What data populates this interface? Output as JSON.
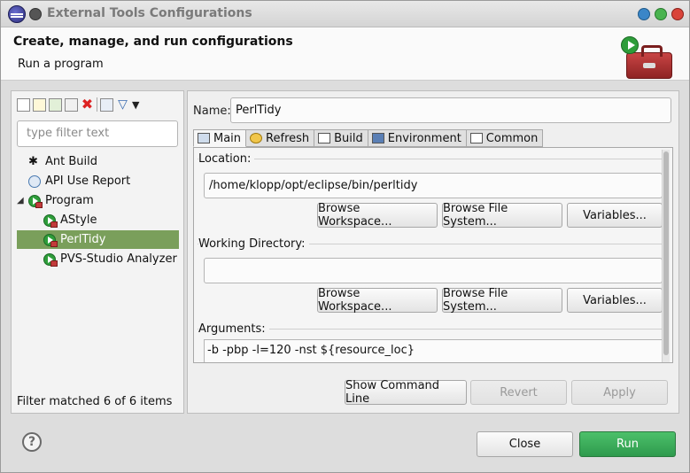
{
  "window": {
    "title": "External Tools Configurations"
  },
  "header": {
    "title": "Create, manage, and run configurations",
    "subtitle": "Run a program"
  },
  "left": {
    "filter_placeholder": "type filter text",
    "tree": [
      {
        "label": "Ant Build",
        "icon": "ant-icon",
        "level": 1
      },
      {
        "label": "API Use Report",
        "icon": "api-report-icon",
        "level": 1
      },
      {
        "label": "Program",
        "icon": "program-icon",
        "level": 0,
        "expanded": true
      },
      {
        "label": "AStyle",
        "icon": "program-config-icon",
        "level": 1
      },
      {
        "label": "PerlTidy",
        "icon": "program-config-icon",
        "level": 1,
        "selected": true
      },
      {
        "label": "PVS-Studio Analyzer",
        "icon": "program-config-icon",
        "level": 1
      }
    ],
    "status": "Filter matched 6 of 6 items"
  },
  "right": {
    "name_label": "Name:",
    "name_value": "PerlTidy",
    "tabs": [
      {
        "label": "Main",
        "icon": "main-tab-icon",
        "active": true
      },
      {
        "label": "Refresh",
        "icon": "refresh-icon"
      },
      {
        "label": "Build",
        "icon": "build-icon"
      },
      {
        "label": "Environment",
        "icon": "environment-icon"
      },
      {
        "label": "Common",
        "icon": "common-icon"
      }
    ],
    "location": {
      "label": "Location:",
      "value": "/home/klopp/opt/eclipse/bin/perltidy",
      "browse_workspace": "Browse Workspace...",
      "browse_file_system": "Browse File System...",
      "variables": "Variables..."
    },
    "working_dir": {
      "label": "Working Directory:",
      "value": "",
      "browse_workspace": "Browse Workspace...",
      "browse_file_system": "Browse File System...",
      "variables": "Variables..."
    },
    "arguments": {
      "label": "Arguments:",
      "value": "-b -pbp -l=120 -nst ${resource_loc}"
    },
    "show_command_line": "Show Command Line",
    "revert": "Revert",
    "apply": "Apply"
  },
  "footer": {
    "help": "?",
    "close": "Close",
    "run": "Run"
  },
  "colors": {
    "selection": "#7a9f5b",
    "run_button": "#3aae5a"
  }
}
